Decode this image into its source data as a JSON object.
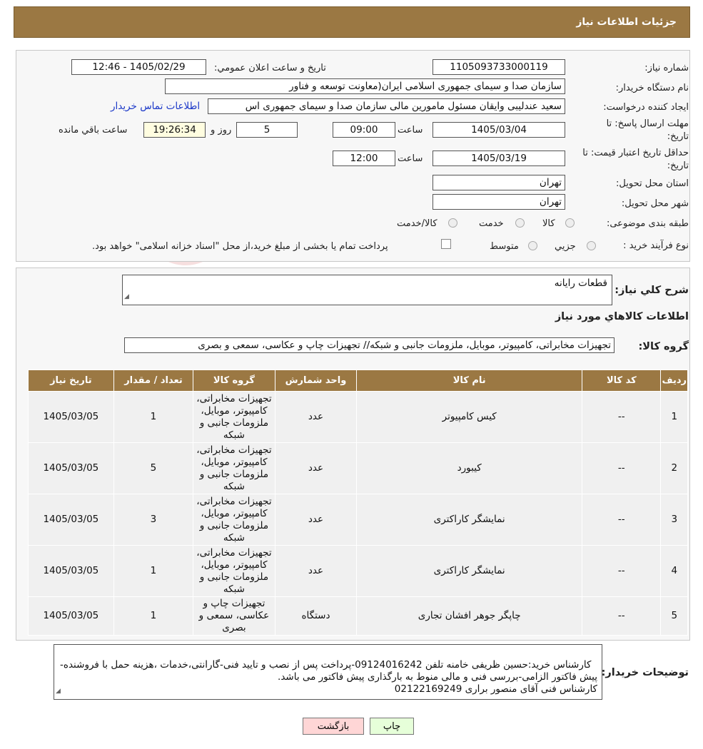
{
  "header": {
    "title": "جزئیات اطلاعات نیاز"
  },
  "form": {
    "need_number_label": "شماره نیاز:",
    "need_number": "1105093733000119",
    "announce_label": "تاریخ و ساعت اعلان عمومي:",
    "announce_value": "1405/02/29 - 12:46",
    "buyer_org_label": "نام دستگاه خریدار:",
    "buyer_org": "سازمان صدا و سیمای جمهوری اسلامی ایران(معاونت توسعه و فناور",
    "creator_label": "ایجاد کننده درخواست:",
    "creator": "سعید عندلیبی وایقان مسئول مامورین مالی  سازمان صدا و سیمای جمهوری اس",
    "contact_link": "اطلاعات تماس خریدار",
    "deadline_label_1": "مهلت ارسال پاسخ: تا",
    "deadline_label_2": "تاریخ:",
    "deadline_date": "1405/03/04",
    "time_label": "ساعت",
    "deadline_time": "09:00",
    "days_value": "5",
    "days_label": "روز و",
    "remaining_time": "19:26:34",
    "remaining_label": "ساعت باقي مانده",
    "validity_label_1": "حداقل تاریخ اعتبار قیمت: تا",
    "validity_label_2": "تاریخ:",
    "validity_date": "1405/03/19",
    "validity_time": "12:00",
    "province_label": "استان محل تحویل:",
    "province": "تهران",
    "city_label": "شهر محل تحویل:",
    "city": "تهران",
    "category_label": "طبقه بندی موضوعی:",
    "category_options": [
      "کالا",
      "خدمت",
      "کالا/خدمت"
    ],
    "process_label": "نوع فرآیند خرید :",
    "process_options": [
      "جزیي",
      "متوسط"
    ],
    "process_note": "پرداخت تمام یا بخشی از مبلغ خرید،از محل \"اسناد خزانه اسلامی\" خواهد بود."
  },
  "need": {
    "summary_label": "شرح کلي نیاز:",
    "summary": "قطعات رایانه",
    "goods_info_title": "اطلاعات کالاهاي مورد نیاز",
    "goods_group_label": "گروه کالا:",
    "goods_group": "تجهیزات مخابراتی، کامپیوتر، موبایل، ملزومات جانبی و شبکه// تجهیزات چاپ و عکاسی، سمعی و بصری"
  },
  "table": {
    "headers": [
      "ردیف",
      "کد کالا",
      "نام کالا",
      "واحد شمارش",
      "گروه کالا",
      "تعداد / مقدار",
      "تاریخ نیاز"
    ],
    "rows": [
      [
        "1",
        "--",
        "کیس کامپیوتر",
        "عدد",
        "تجهیزات مخابراتی، کامپیوتر، موبایل، ملزومات جانبی و شبکه",
        "1",
        "1405/03/05"
      ],
      [
        "2",
        "--",
        "کیبورد",
        "عدد",
        "تجهیزات مخابراتی، کامپیوتر، موبایل، ملزومات جانبی و شبکه",
        "5",
        "1405/03/05"
      ],
      [
        "3",
        "--",
        "نمایشگر کاراکتری",
        "عدد",
        "تجهیزات مخابراتی، کامپیوتر، موبایل، ملزومات جانبی و شبکه",
        "3",
        "1405/03/05"
      ],
      [
        "4",
        "--",
        "نمایشگر کاراکتری",
        "عدد",
        "تجهیزات مخابراتی، کامپیوتر، موبایل، ملزومات جانبی و شبکه",
        "1",
        "1405/03/05"
      ],
      [
        "5",
        "--",
        "چاپگر جوهر افشان تجاری",
        "دستگاه",
        "تجهیزات چاپ و عکاسی، سمعی و بصری",
        "1",
        "1405/03/05"
      ]
    ]
  },
  "buyer_notes": {
    "label": "توضیحات خریدار:",
    "text": "کارشناس خرید:حسین ظریفی خامنه تلفن 09124016242-پرداخت پس از نصب و تایید فنی-گارانتی،خدمات ،هزینه حمل با فروشنده-پیش فاکتور الزامی-بررسی فنی و مالی منوط به بارگذاری پیش فاکتور می باشد.\nکارشناس فنی آقای منصور براری 02122169249"
  },
  "buttons": {
    "print": "چاپ",
    "back": "بازگشت"
  },
  "colors": {
    "header": "#9b7843",
    "print_bg": "#e6ffd9",
    "back_bg": "#ffd6d6"
  }
}
